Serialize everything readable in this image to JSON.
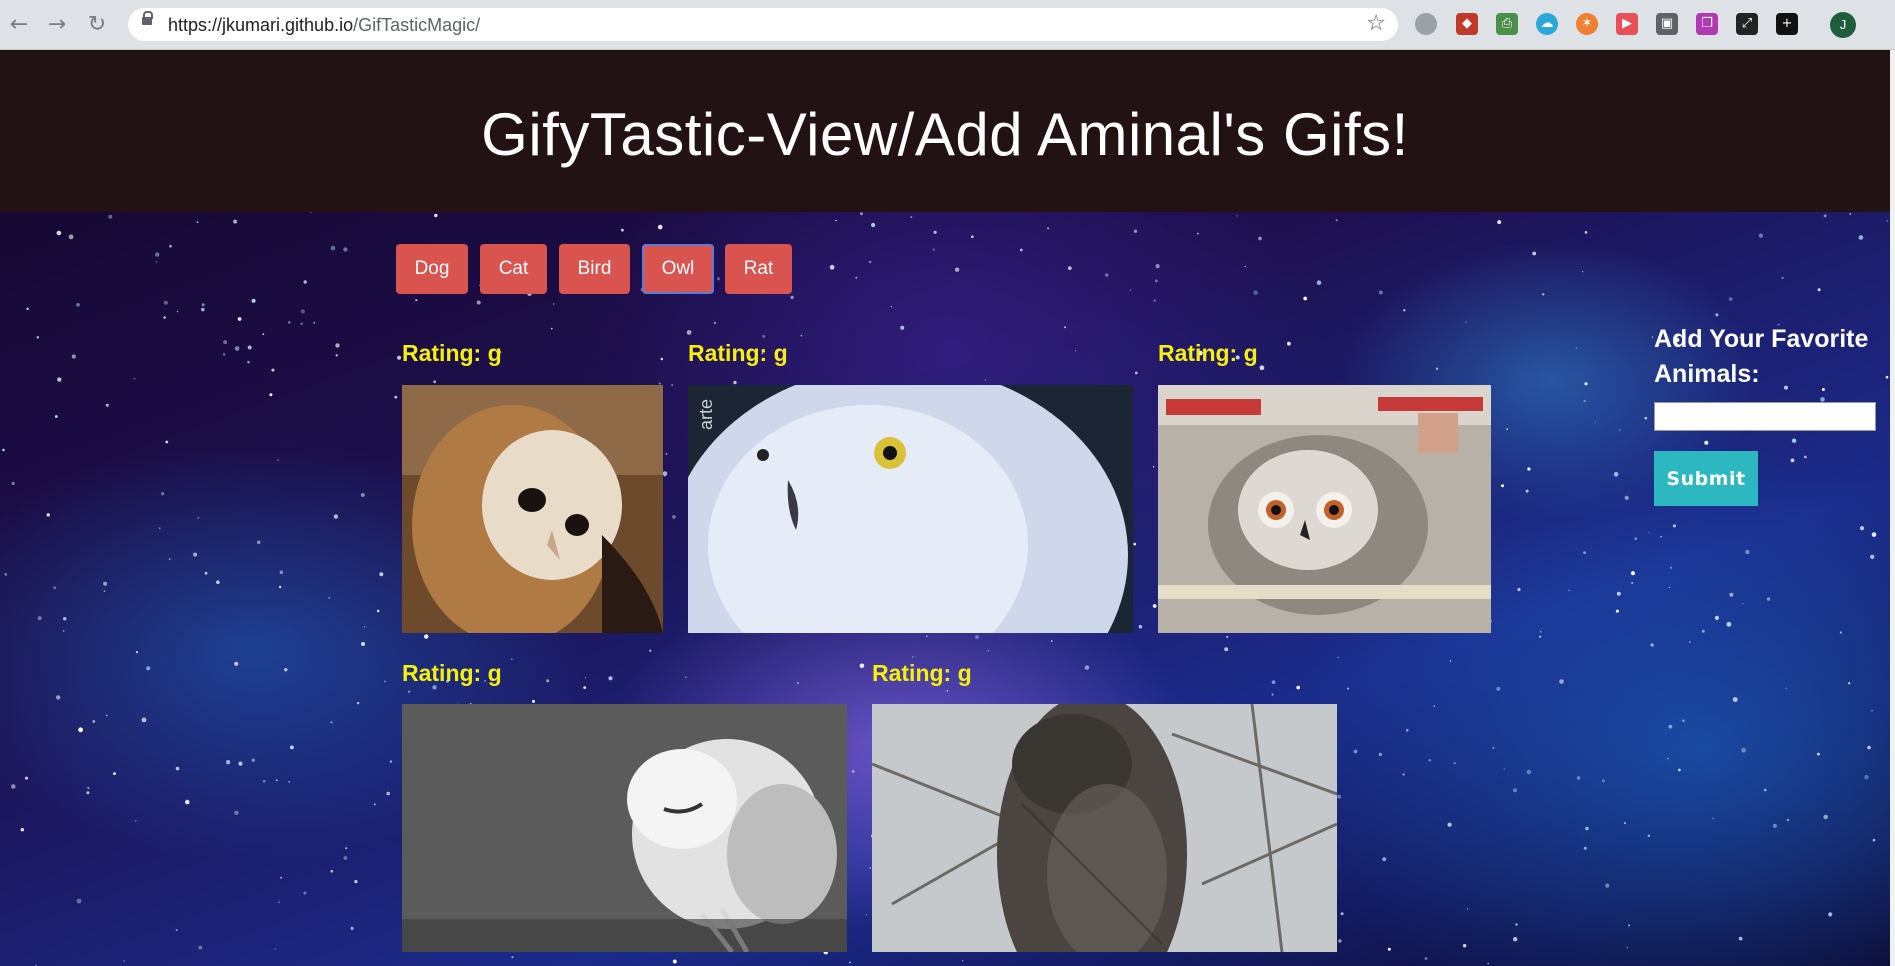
{
  "browser": {
    "url_host": "https://jkumari.github.io",
    "url_path": "/GifTasticMagic/",
    "avatar_initial": "J"
  },
  "header": {
    "title": "GifyTastic-View/Add Aminal's Gifs!"
  },
  "animal_buttons": [
    {
      "label": "Dog"
    },
    {
      "label": "Cat"
    },
    {
      "label": "Bird"
    },
    {
      "label": "Owl",
      "active": true
    },
    {
      "label": "Rat"
    }
  ],
  "gifs": [
    {
      "rating": "Rating: g",
      "subject": "barn owl"
    },
    {
      "rating": "Rating: g",
      "subject": "snowy owl close-up"
    },
    {
      "rating": "Rating: g",
      "subject": "white-faced scops owl"
    },
    {
      "rating": "Rating: g",
      "subject": "barn owl on grass"
    },
    {
      "rating": "Rating: g",
      "subject": "great grey owl"
    }
  ],
  "sidebar": {
    "label": "Add Your Favorite Animals:",
    "input_value": "",
    "submit_label": "Submit"
  },
  "colors": {
    "header_bg": "#231213",
    "button_bg": "#d9534f",
    "rating_text": "#f5f10a",
    "submit_bg": "#2db7c0"
  }
}
